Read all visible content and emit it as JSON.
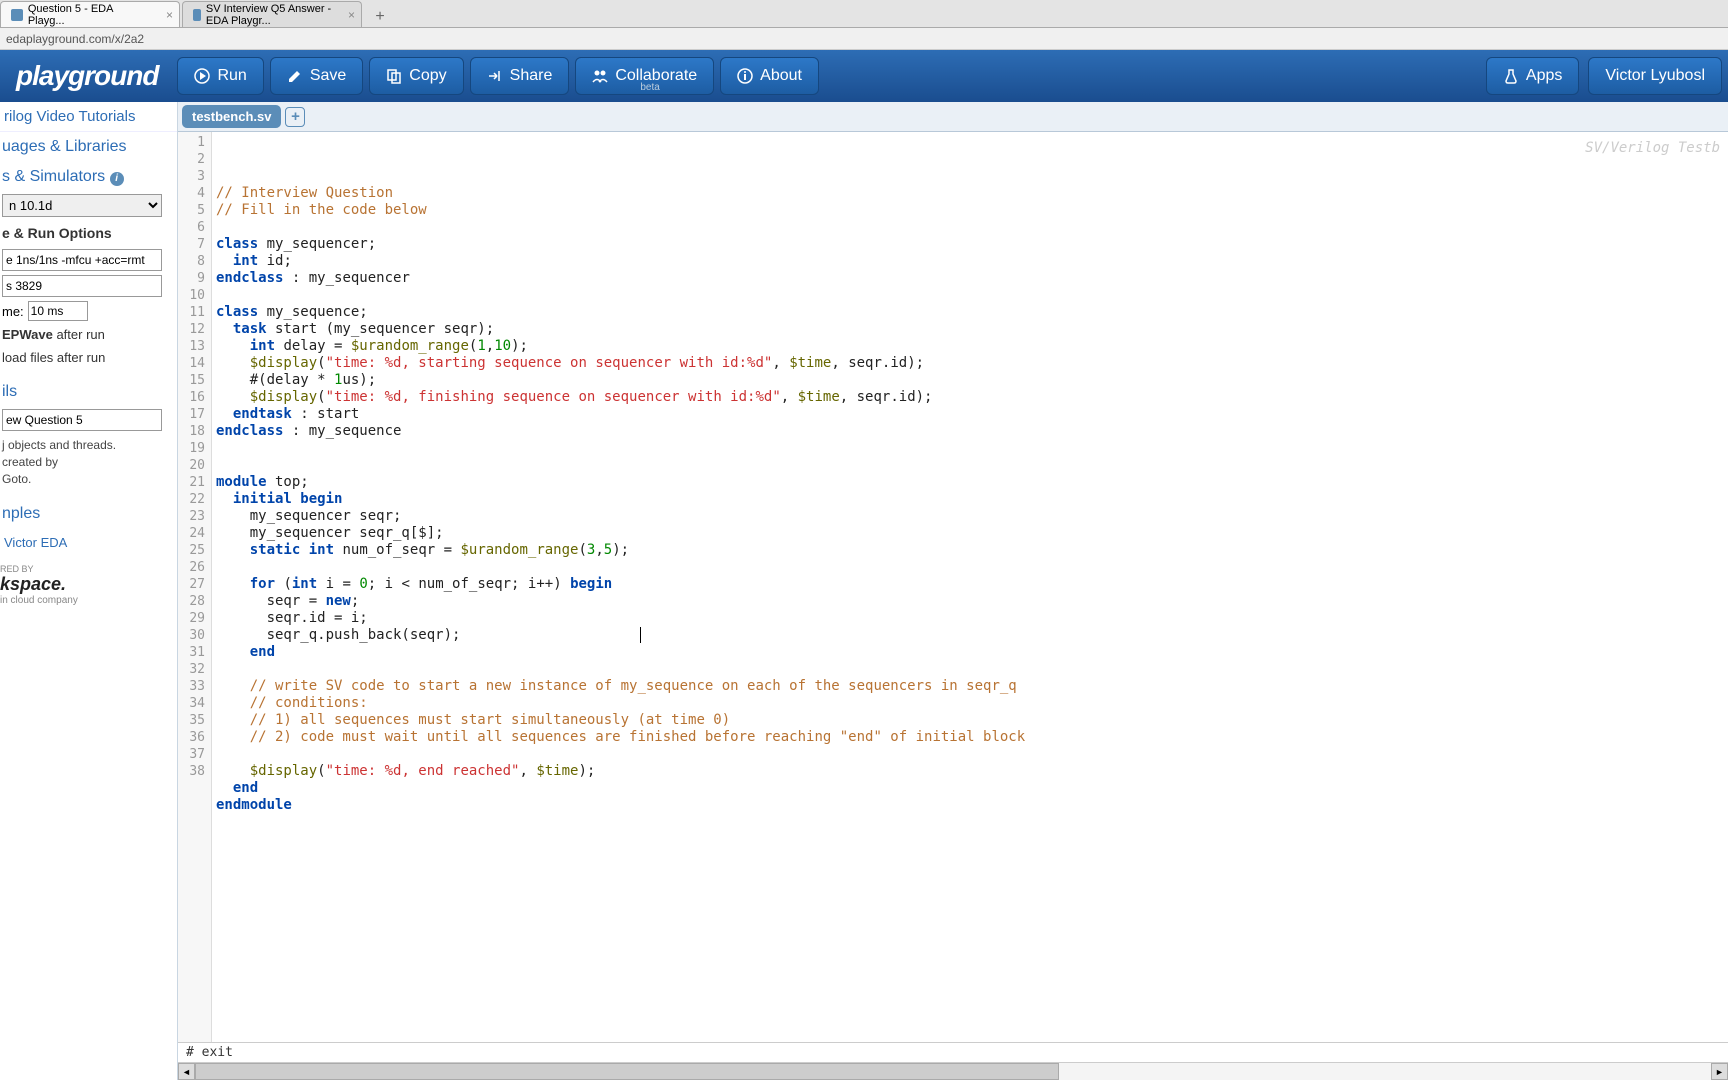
{
  "browser": {
    "tabs": [
      {
        "title": "Question 5 - EDA Playg...",
        "active": true
      },
      {
        "title": "SV Interview Q5 Answer - EDA Playgr...",
        "active": false
      }
    ],
    "url": "edaplayground.com/x/2a2"
  },
  "toolbar": {
    "logo": "playground",
    "run": "Run",
    "save": "Save",
    "copy": "Copy",
    "share": "Share",
    "collaborate": "Collaborate",
    "collaborate_beta": "beta",
    "about": "About",
    "apps": "Apps",
    "user": "Victor Lyubosl"
  },
  "sidebar": {
    "link_tutorials": "rilog Video Tutorials",
    "section_languages": "uages & Libraries",
    "section_simulators": "s & Simulators",
    "simulator_value": "n 10.1d",
    "section_options": "e & Run Options",
    "options_value": "e 1ns/1ns -mfcu +acc=rmt",
    "seed_value": "s 3829",
    "runtime_label": "me:",
    "runtime_value": "10 ms",
    "checkbox_epwave": "EPWave after run",
    "checkbox_upload": "load files after run",
    "section_ils": "ils",
    "name_value": "ew Question 5",
    "description_text": "j objects and threads.\ncreated by\nGoto.",
    "section_examples": "nples",
    "author_link": "Victor EDA",
    "sponsor_by": "RED BY",
    "sponsor_name": "kspace.",
    "sponsor_tag": "in cloud company"
  },
  "editor": {
    "filename": "testbench.sv",
    "watermark": "SV/Verilog Testb",
    "console_line": "#  exit"
  },
  "code": {
    "lines": [
      [
        [
          "c-comment",
          "// Interview Question"
        ]
      ],
      [
        [
          "c-comment",
          "// Fill in the code below"
        ]
      ],
      [],
      [
        [
          "c-keyword",
          "class"
        ],
        [
          "c-plain",
          " my_sequencer;"
        ]
      ],
      [
        [
          "c-plain",
          "  "
        ],
        [
          "c-type",
          "int"
        ],
        [
          "c-plain",
          " id;"
        ]
      ],
      [
        [
          "c-keyword",
          "endclass"
        ],
        [
          "c-plain",
          " : my_sequencer"
        ]
      ],
      [],
      [
        [
          "c-keyword",
          "class"
        ],
        [
          "c-plain",
          " my_sequence;"
        ]
      ],
      [
        [
          "c-plain",
          "  "
        ],
        [
          "c-keyword",
          "task"
        ],
        [
          "c-plain",
          " start (my_sequencer seqr);"
        ]
      ],
      [
        [
          "c-plain",
          "    "
        ],
        [
          "c-type",
          "int"
        ],
        [
          "c-plain",
          " delay = "
        ],
        [
          "c-func",
          "$urandom_range"
        ],
        [
          "c-plain",
          "("
        ],
        [
          "c-num",
          "1"
        ],
        [
          "c-plain",
          ","
        ],
        [
          "c-num",
          "10"
        ],
        [
          "c-plain",
          ");"
        ]
      ],
      [
        [
          "c-plain",
          "    "
        ],
        [
          "c-func",
          "$display"
        ],
        [
          "c-plain",
          "("
        ],
        [
          "c-string",
          "\"time: %d, starting sequence on sequencer with id:%d\""
        ],
        [
          "c-plain",
          ", "
        ],
        [
          "c-func",
          "$time"
        ],
        [
          "c-plain",
          ", seqr.id);"
        ]
      ],
      [
        [
          "c-plain",
          "    #(delay * "
        ],
        [
          "c-num",
          "1"
        ],
        [
          "c-plain",
          "us);"
        ]
      ],
      [
        [
          "c-plain",
          "    "
        ],
        [
          "c-func",
          "$display"
        ],
        [
          "c-plain",
          "("
        ],
        [
          "c-string",
          "\"time: %d, finishing sequence on sequencer with id:%d\""
        ],
        [
          "c-plain",
          ", "
        ],
        [
          "c-func",
          "$time"
        ],
        [
          "c-plain",
          ", seqr.id);"
        ]
      ],
      [
        [
          "c-plain",
          "  "
        ],
        [
          "c-keyword",
          "endtask"
        ],
        [
          "c-plain",
          " : start"
        ]
      ],
      [
        [
          "c-keyword",
          "endclass"
        ],
        [
          "c-plain",
          " : my_sequence"
        ]
      ],
      [],
      [],
      [
        [
          "c-keyword",
          "module"
        ],
        [
          "c-plain",
          " top;"
        ]
      ],
      [
        [
          "c-plain",
          "  "
        ],
        [
          "c-keyword",
          "initial begin"
        ]
      ],
      [
        [
          "c-plain",
          "    my_sequencer seqr;"
        ]
      ],
      [
        [
          "c-plain",
          "    my_sequencer seqr_q[$];"
        ]
      ],
      [
        [
          "c-plain",
          "    "
        ],
        [
          "c-keyword",
          "static"
        ],
        [
          "c-plain",
          " "
        ],
        [
          "c-type",
          "int"
        ],
        [
          "c-plain",
          " num_of_seqr = "
        ],
        [
          "c-func",
          "$urandom_range"
        ],
        [
          "c-plain",
          "("
        ],
        [
          "c-num",
          "3"
        ],
        [
          "c-plain",
          ","
        ],
        [
          "c-num",
          "5"
        ],
        [
          "c-plain",
          ");"
        ]
      ],
      [],
      [
        [
          "c-plain",
          "    "
        ],
        [
          "c-keyword",
          "for"
        ],
        [
          "c-plain",
          " ("
        ],
        [
          "c-type",
          "int"
        ],
        [
          "c-plain",
          " i = "
        ],
        [
          "c-num",
          "0"
        ],
        [
          "c-plain",
          "; i < num_of_seqr; i++) "
        ],
        [
          "c-keyword",
          "begin"
        ]
      ],
      [
        [
          "c-plain",
          "      seqr = "
        ],
        [
          "c-keyword",
          "new"
        ],
        [
          "c-plain",
          ";"
        ]
      ],
      [
        [
          "c-plain",
          "      seqr.id = i;"
        ]
      ],
      [
        [
          "c-plain",
          "      seqr_q.push_back(seqr);"
        ]
      ],
      [
        [
          "c-plain",
          "    "
        ],
        [
          "c-keyword",
          "end"
        ]
      ],
      [],
      [
        [
          "c-plain",
          "    "
        ],
        [
          "c-comment",
          "// write SV code to start a new instance of my_sequence on each of the sequencers in seqr_q"
        ]
      ],
      [
        [
          "c-plain",
          "    "
        ],
        [
          "c-comment",
          "// conditions:"
        ]
      ],
      [
        [
          "c-plain",
          "    "
        ],
        [
          "c-comment",
          "// 1) all sequences must start simultaneously (at time 0)"
        ]
      ],
      [
        [
          "c-plain",
          "    "
        ],
        [
          "c-comment",
          "// 2) code must wait until all sequences are finished before reaching \"end\" of initial block"
        ]
      ],
      [],
      [
        [
          "c-plain",
          "    "
        ],
        [
          "c-func",
          "$display"
        ],
        [
          "c-plain",
          "("
        ],
        [
          "c-string",
          "\"time: %d, end reached\""
        ],
        [
          "c-plain",
          ", "
        ],
        [
          "c-func",
          "$time"
        ],
        [
          "c-plain",
          ");"
        ]
      ],
      [
        [
          "c-plain",
          "  "
        ],
        [
          "c-keyword",
          "end"
        ]
      ],
      [
        [
          "c-keyword",
          "endmodule"
        ]
      ],
      []
    ]
  }
}
